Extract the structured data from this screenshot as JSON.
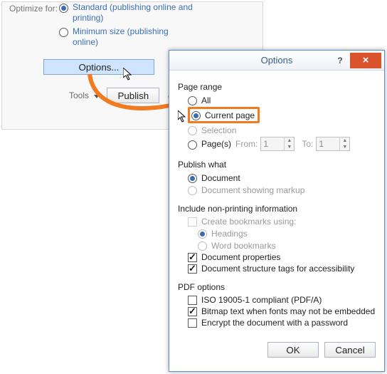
{
  "back": {
    "optimize_label": "Optimize for:",
    "standard": "Standard (publishing online and printing)",
    "minimum": "Minimum size (publishing online)",
    "options_button": "Options...",
    "tools": "Tools",
    "publish": "Publish"
  },
  "dialog": {
    "title": "Options",
    "page_range": {
      "label": "Page range",
      "all": "All",
      "current": "Current page",
      "selection": "Selection",
      "pages": "Page(s)",
      "from": "From:",
      "to": "To:",
      "from_val": "1",
      "to_val": "1"
    },
    "publish_what": {
      "label": "Publish what",
      "document": "Document",
      "markup": "Document showing markup"
    },
    "include": {
      "label": "Include non-printing information",
      "bookmarks": "Create bookmarks using:",
      "headings": "Headings",
      "wordbm": "Word bookmarks",
      "docprops": "Document properties",
      "structtags": "Document structure tags for accessibility"
    },
    "pdf": {
      "label": "PDF options",
      "iso": "ISO 19005-1 compliant (PDF/A)",
      "bitmap": "Bitmap text when fonts may not be embedded",
      "encrypt": "Encrypt the document with a password"
    },
    "ok": "OK",
    "cancel": "Cancel"
  }
}
